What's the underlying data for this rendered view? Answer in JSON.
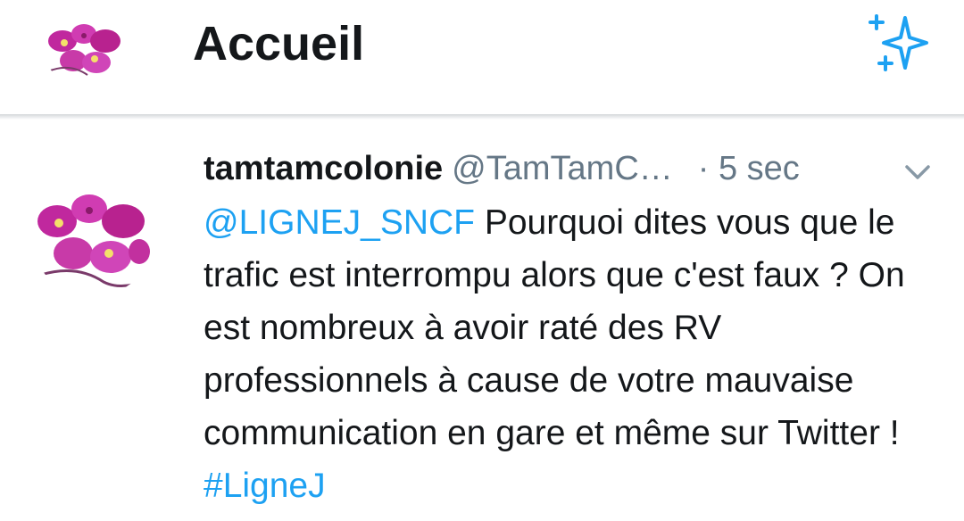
{
  "header": {
    "title": "Accueil",
    "avatar_icon": "orchid-avatar",
    "action_icon": "sparkle-icon",
    "accent_color": "#1da1f2"
  },
  "tweet": {
    "display_name": "tamtamcolonie",
    "handle": "@TamTamC…",
    "time": "· 5 sec",
    "menu_icon": "chevron-down-icon",
    "mention": "@LIGNEJ_SNCF",
    "text": " Pourquoi dites vous que le trafic est interrompu alors que c'est faux ? On est nombreux à avoir raté des RV professionnels à cause de votre mauvaise communication en gare et même sur Twitter ! ",
    "hashtag": "#LigneJ"
  }
}
